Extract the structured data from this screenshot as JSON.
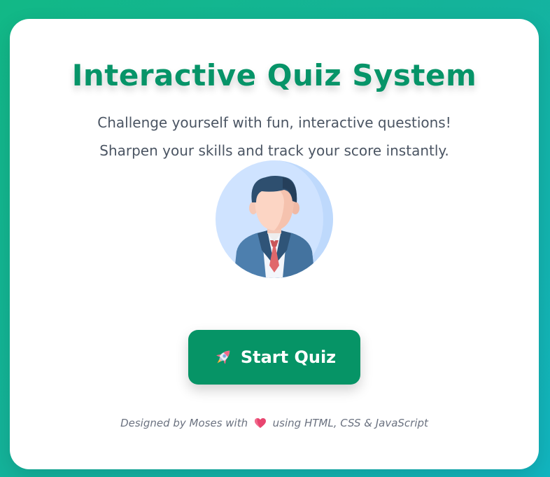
{
  "header": {
    "title": "Interactive Quiz System"
  },
  "intro": {
    "line1": "Challenge yourself with fun, interactive questions!",
    "line2": "Sharpen your skills and track your score instantly."
  },
  "avatar": {
    "icon": "businessman-avatar-icon"
  },
  "actions": {
    "start_label": "Start Quiz",
    "start_icon": "rocket-icon"
  },
  "footer": {
    "before": "Designed by Moses with",
    "after": "using HTML, CSS & JavaScript",
    "icon": "heart-icon"
  },
  "colors": {
    "accent": "#069466",
    "title": "#069468",
    "background_start": "#12b886",
    "background_end": "#12b5c0"
  }
}
